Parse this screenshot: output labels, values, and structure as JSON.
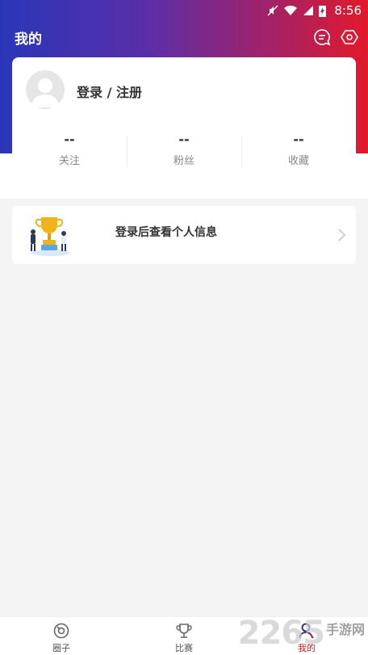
{
  "status_bar": {
    "time": "8:56"
  },
  "header": {
    "title": "我的"
  },
  "profile": {
    "login_label": "登录 / 注册"
  },
  "stats": [
    {
      "value": "--",
      "label": "关注"
    },
    {
      "value": "--",
      "label": "粉丝"
    },
    {
      "value": "--",
      "label": "收藏"
    }
  ],
  "info_card": {
    "text": "登录后查看个人信息"
  },
  "tabs": [
    {
      "label": "圈子",
      "icon": "circle-icon"
    },
    {
      "label": "比赛",
      "icon": "trophy-icon"
    },
    {
      "label": "我的",
      "icon": "person-icon"
    }
  ],
  "watermark": {
    "number": "2265",
    "text": "手游网"
  },
  "colors": {
    "accent": "#d11a2a",
    "gradient_start": "#2a36b8",
    "gradient_end": "#e21a2a"
  }
}
